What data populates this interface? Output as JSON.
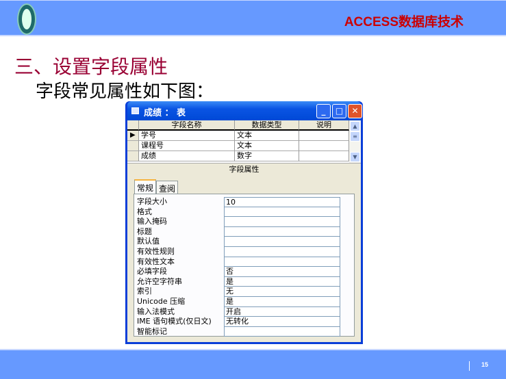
{
  "header": {
    "brand": "ACCESS数据库技术"
  },
  "slide": {
    "title": "三、设置字段属性",
    "subtitle": "字段常见属性如下图："
  },
  "window": {
    "title": "成绩 ： 表",
    "buttons": {
      "minimize": "_",
      "maximize": "□",
      "close": "✕"
    },
    "grid": {
      "columns": [
        "字段名称",
        "数据类型",
        "说明"
      ],
      "rows": [
        {
          "name": "学号",
          "type": "文本",
          "desc": ""
        },
        {
          "name": "课程号",
          "type": "文本",
          "desc": ""
        },
        {
          "name": "成绩",
          "type": "数字",
          "desc": ""
        }
      ]
    },
    "field_properties_label": "字段属性",
    "tabs": [
      "常规",
      "查阅"
    ],
    "properties": [
      {
        "label": "字段大小",
        "value": "10"
      },
      {
        "label": "格式",
        "value": ""
      },
      {
        "label": "输入掩码",
        "value": ""
      },
      {
        "label": "标题",
        "value": ""
      },
      {
        "label": "默认值",
        "value": ""
      },
      {
        "label": "有效性规则",
        "value": ""
      },
      {
        "label": "有效性文本",
        "value": ""
      },
      {
        "label": "必填字段",
        "value": "否"
      },
      {
        "label": "允许空字符串",
        "value": "是"
      },
      {
        "label": "索引",
        "value": "无"
      },
      {
        "label": "Unicode 压缩",
        "value": "是"
      },
      {
        "label": "输入法模式",
        "value": "开启"
      },
      {
        "label": "IME 语句模式(仅日文)",
        "value": "无转化"
      },
      {
        "label": "智能标记",
        "value": ""
      }
    ]
  },
  "footer": {
    "page": "15"
  }
}
